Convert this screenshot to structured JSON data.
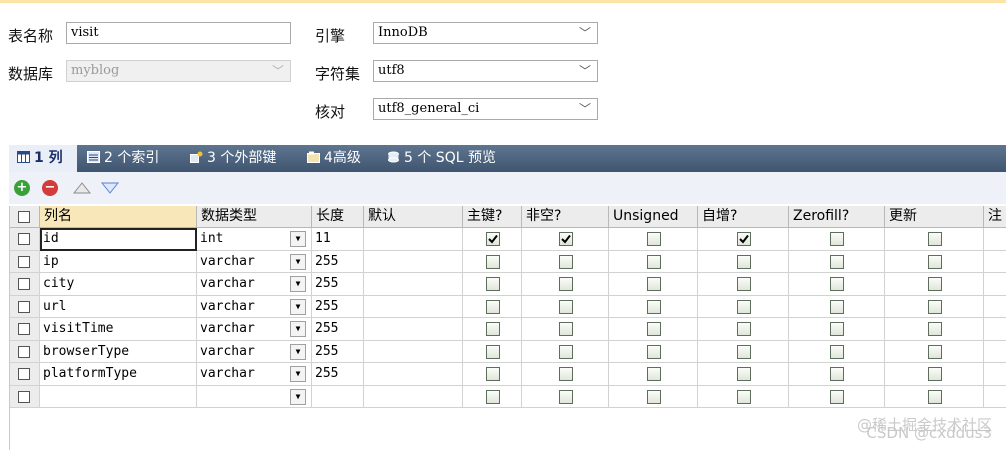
{
  "form": {
    "table_name_label": "表名称",
    "table_name_value": "visit",
    "database_label": "数据库",
    "database_value": "myblog",
    "engine_label": "引擎",
    "engine_value": "InnoDB",
    "charset_label": "字符集",
    "charset_value": "utf8",
    "collation_label": "核对",
    "collation_value": "utf8_general_ci"
  },
  "tabs": [
    {
      "label": "1 列",
      "icon": "columns-icon",
      "active": true
    },
    {
      "label": "2 个索引",
      "icon": "index-icon"
    },
    {
      "label": "3 个外部键",
      "icon": "foreign-key-icon"
    },
    {
      "label": "4高级",
      "icon": "advanced-icon"
    },
    {
      "label": "5 个 SQL 预览",
      "icon": "sql-preview-icon"
    }
  ],
  "toolbar": {
    "add_icon": "add-icon",
    "remove_icon": "remove-icon",
    "up_icon": "move-up-icon",
    "down_icon": "move-down-icon"
  },
  "columns_header": [
    "列名",
    "数据类型",
    "长度",
    "默认",
    "主键?",
    "非空?",
    "Unsigned",
    "自增?",
    "Zerofill?",
    "更新",
    "注"
  ],
  "rows": [
    {
      "name": "id",
      "type": "int",
      "length": "11",
      "default": "",
      "pk": true,
      "not_null": true,
      "unsigned": false,
      "auto_inc": true,
      "zerofill": false,
      "update": false
    },
    {
      "name": "ip",
      "type": "varchar",
      "length": "255",
      "default": "",
      "pk": false,
      "not_null": false,
      "unsigned": false,
      "auto_inc": false,
      "zerofill": false,
      "update": false
    },
    {
      "name": "city",
      "type": "varchar",
      "length": "255",
      "default": "",
      "pk": false,
      "not_null": false,
      "unsigned": false,
      "auto_inc": false,
      "zerofill": false,
      "update": false
    },
    {
      "name": "url",
      "type": "varchar",
      "length": "255",
      "default": "",
      "pk": false,
      "not_null": false,
      "unsigned": false,
      "auto_inc": false,
      "zerofill": false,
      "update": false
    },
    {
      "name": "visitTime",
      "type": "varchar",
      "length": "255",
      "default": "",
      "pk": false,
      "not_null": false,
      "unsigned": false,
      "auto_inc": false,
      "zerofill": false,
      "update": false
    },
    {
      "name": "browserType",
      "type": "varchar",
      "length": "255",
      "default": "",
      "pk": false,
      "not_null": false,
      "unsigned": false,
      "auto_inc": false,
      "zerofill": false,
      "update": false
    },
    {
      "name": "platformType",
      "type": "varchar",
      "length": "255",
      "default": "",
      "pk": false,
      "not_null": false,
      "unsigned": false,
      "auto_inc": false,
      "zerofill": false,
      "update": false
    },
    {
      "name": "",
      "type": "",
      "length": "",
      "default": "",
      "pk": false,
      "not_null": false,
      "unsigned": false,
      "auto_inc": false,
      "zerofill": false,
      "update": false
    }
  ],
  "watermark": {
    "line1": "@稀土掘金技术社区",
    "line2": "CSDN @cxddus3"
  },
  "colors": {
    "tab_bar": "#4a607c",
    "accent_header": "#f8e7b9",
    "add_green": "#3aa13a",
    "remove_red": "#d43b3b"
  }
}
